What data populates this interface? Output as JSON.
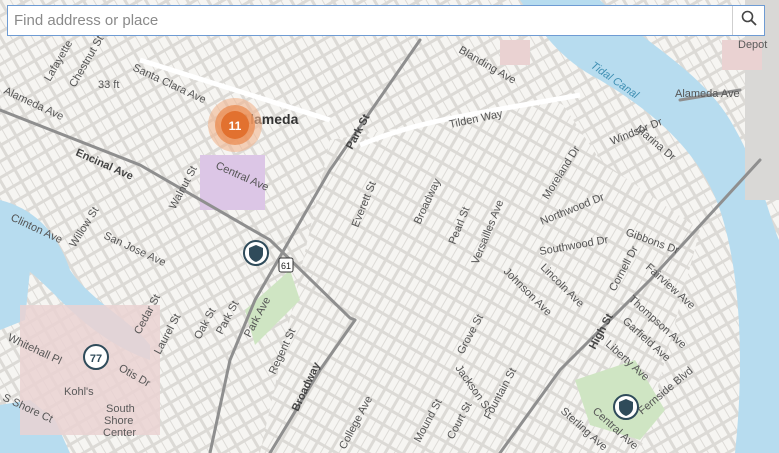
{
  "search": {
    "placeholder": "Find address or place"
  },
  "colors": {
    "water": "#b7dcef",
    "land": "#e9e7e3",
    "block": "#f6f5f2",
    "road": "#ffffff",
    "major_road": "#8f8f8f",
    "park": "#cfe5c3",
    "school": "#dcc6e6",
    "commercial": "#ead2d2",
    "cluster": "#e2712f",
    "marker": "#2f4b5a"
  },
  "cluster": {
    "count": "11"
  },
  "highway_shields": [
    "61",
    "77"
  ],
  "labels": {
    "city": "Alameda",
    "water": "Tidal Canal",
    "places": [
      "Depot",
      "Kohl's",
      "South",
      "Shore",
      "Center"
    ],
    "streets": [
      "Blanding Ave",
      "Alameda Ave",
      "Tilden Way",
      "Park St",
      "Lafayette",
      "Chestnut St",
      "33 ft",
      "Santa Clara Ave",
      "Alameda Ave",
      "Encinal Ave",
      "Central Ave",
      "Walnut St",
      "Clinton Ave",
      "Willow St",
      "San Jose Ave",
      "Everett St",
      "Broadway",
      "Pearl St",
      "Versailles Ave",
      "Moreland Dr",
      "Northwood Dr",
      "Windsor Dr",
      "Marina Dr",
      "Gibbons Dr",
      "Southwood Dr",
      "Lincoln Ave",
      "Johnson Ave",
      "Cornell Dr",
      "Fairview Ave",
      "Thompson Ave",
      "Garfield Ave",
      "Liberty Ave",
      "Fernside Blvd",
      "High St",
      "Central Ave",
      "Sterling Ave",
      "Cedar St",
      "Laurel St",
      "Oak St",
      "Park St",
      "Park Ave",
      "Regent St",
      "Grove St",
      "Jackson St",
      "Fountain St",
      "Court St",
      "Mound St",
      "College Ave",
      "Otis Dr",
      "Whitehall Pl",
      "S Shore Ct",
      "Broadway"
    ]
  }
}
